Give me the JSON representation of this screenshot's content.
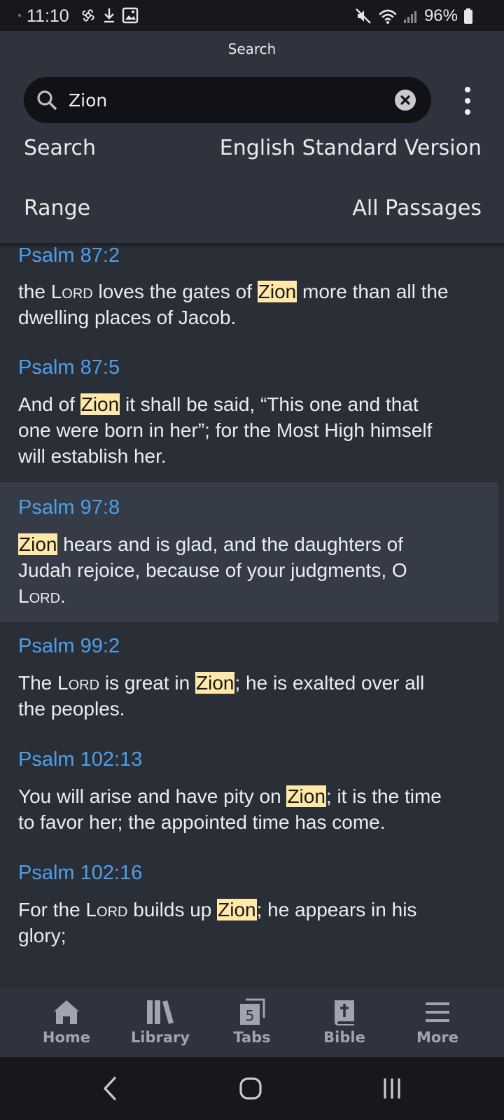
{
  "status_bar": {
    "time": "11:10",
    "battery": "96%"
  },
  "header": {
    "title": "Search",
    "search_value": "Zion",
    "search_label": "Search",
    "search_value_label": "English Standard Version",
    "range_label": "Range",
    "range_value": "All Passages"
  },
  "results": [
    {
      "ref": "Psalm 87:2",
      "parts": [
        "the ",
        "Lord",
        " loves the gates of ",
        "Zion",
        " more than all the"
      ],
      "line2": "dwelling places of Jacob."
    },
    {
      "ref": "Psalm 87:5",
      "line1a": "And of ",
      "hl": "Zion",
      "line1b": " it shall be said, “This one and that",
      "line2": "one were born in her”; for the Most High himself",
      "line3": "will establish her."
    },
    {
      "ref": "Psalm 97:8",
      "hl": "Zion",
      "line1b": " hears and is glad, and the daughters of",
      "line2": "Judah rejoice, because of your judgments, O",
      "line3": "Lord",
      "line3b": "."
    },
    {
      "ref": "Psalm 99:2",
      "line1a": "The ",
      "sc": "Lord",
      "line1c": " is great in ",
      "hl": "Zion",
      "line1b": "; he is exalted over all",
      "line2": "the peoples."
    },
    {
      "ref": "Psalm 102:13",
      "line1a": "You will arise and have pity on ",
      "hl": "Zion",
      "line1b": "; it is the time",
      "line2": "to favor her; the appointed time has come."
    },
    {
      "ref": "Psalm 102:16",
      "line1a": "For the ",
      "sc": "Lord",
      "line1c": " builds up ",
      "hl": "Zion",
      "line1b": "; he appears in his",
      "line2": "glory;"
    }
  ],
  "bottom_nav": [
    {
      "label": "Home",
      "icon": "home-icon"
    },
    {
      "label": "Library",
      "icon": "library-icon"
    },
    {
      "label": "Tabs",
      "icon": "tabs-icon",
      "badge": "5"
    },
    {
      "label": "Bible",
      "icon": "bible-icon"
    },
    {
      "label": "More",
      "icon": "menu-icon"
    }
  ],
  "colors": {
    "accent": "#4e9fe8",
    "highlight": "#ffe8a8",
    "background": "#2a2e37",
    "header": "#2e333d"
  }
}
